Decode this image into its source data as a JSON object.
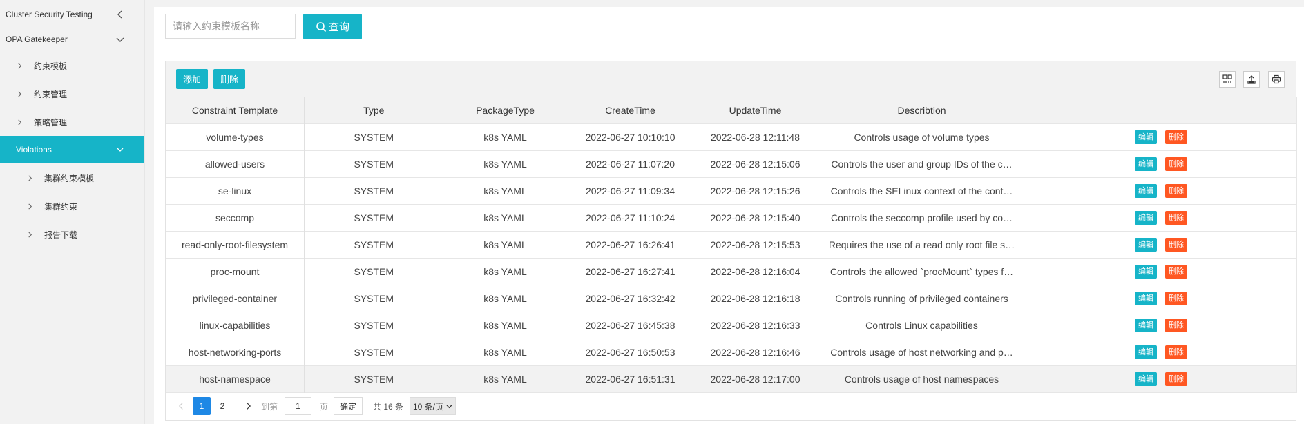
{
  "sidebar": {
    "items": [
      {
        "label": "Cluster Security Testing"
      },
      {
        "label": "OPA Gatekeeper"
      },
      {
        "label": "约束模板"
      },
      {
        "label": "约束管理"
      },
      {
        "label": "策略管理"
      },
      {
        "label": "Violations"
      },
      {
        "label": "集群约束模板"
      },
      {
        "label": "集群约束"
      },
      {
        "label": "报告下载"
      }
    ],
    "active": "Violations"
  },
  "search": {
    "placeholder": "请输入约束模板名称",
    "value": "",
    "button_label": "查询"
  },
  "toolbar": {
    "add_label": "添加",
    "delete_label": "删除"
  },
  "table": {
    "columns": [
      "Constraint Template",
      "Type",
      "PackageType",
      "CreateTime",
      "UpdateTime",
      "Describtion",
      ""
    ],
    "rows": [
      [
        "volume-types",
        "SYSTEM",
        "k8s YAML",
        "2022-06-27 10:10:10",
        "2022-06-28 12:11:48",
        "Controls usage of volume types"
      ],
      [
        "allowed-users",
        "SYSTEM",
        "k8s YAML",
        "2022-06-27 11:07:20",
        "2022-06-28 12:15:06",
        "Controls the user and group IDs of the c…"
      ],
      [
        "se-linux",
        "SYSTEM",
        "k8s YAML",
        "2022-06-27 11:09:34",
        "2022-06-28 12:15:26",
        "Controls the SELinux context of the cont…"
      ],
      [
        "seccomp",
        "SYSTEM",
        "k8s YAML",
        "2022-06-27 11:10:24",
        "2022-06-28 12:15:40",
        "Controls the seccomp profile used by co…"
      ],
      [
        "read-only-root-filesystem",
        "SYSTEM",
        "k8s YAML",
        "2022-06-27 16:26:41",
        "2022-06-28 12:15:53",
        "Requires the use of a read only root file s…"
      ],
      [
        "proc-mount",
        "SYSTEM",
        "k8s YAML",
        "2022-06-27 16:27:41",
        "2022-06-28 12:16:04",
        "Controls the allowed `procMount` types f…"
      ],
      [
        "privileged-container",
        "SYSTEM",
        "k8s YAML",
        "2022-06-27 16:32:42",
        "2022-06-28 12:16:18",
        "Controls running of privileged containers"
      ],
      [
        "linux-capabilities",
        "SYSTEM",
        "k8s YAML",
        "2022-06-27 16:45:38",
        "2022-06-28 12:16:33",
        "Controls Linux capabilities"
      ],
      [
        "host-networking-ports",
        "SYSTEM",
        "k8s YAML",
        "2022-06-27 16:50:53",
        "2022-06-28 12:16:46",
        "Controls usage of host networking and p…"
      ],
      [
        "host-namespace",
        "SYSTEM",
        "k8s YAML",
        "2022-06-27 16:51:31",
        "2022-06-28 12:17:00",
        "Controls usage of host namespaces"
      ]
    ],
    "row_actions": {
      "edit_label": "编辑",
      "delete_label": "删除"
    }
  },
  "pagination": {
    "pages": [
      "1",
      "2"
    ],
    "current_page": "1",
    "goto_prefix": "到第",
    "goto_value": "1",
    "goto_suffix": "页",
    "confirm_label": "确定",
    "total_text": "共 16 条",
    "page_size": "10 条/页"
  },
  "colors": {
    "accent": "#16b4c8",
    "danger": "#ff5722",
    "page_current": "#1e88e5"
  }
}
